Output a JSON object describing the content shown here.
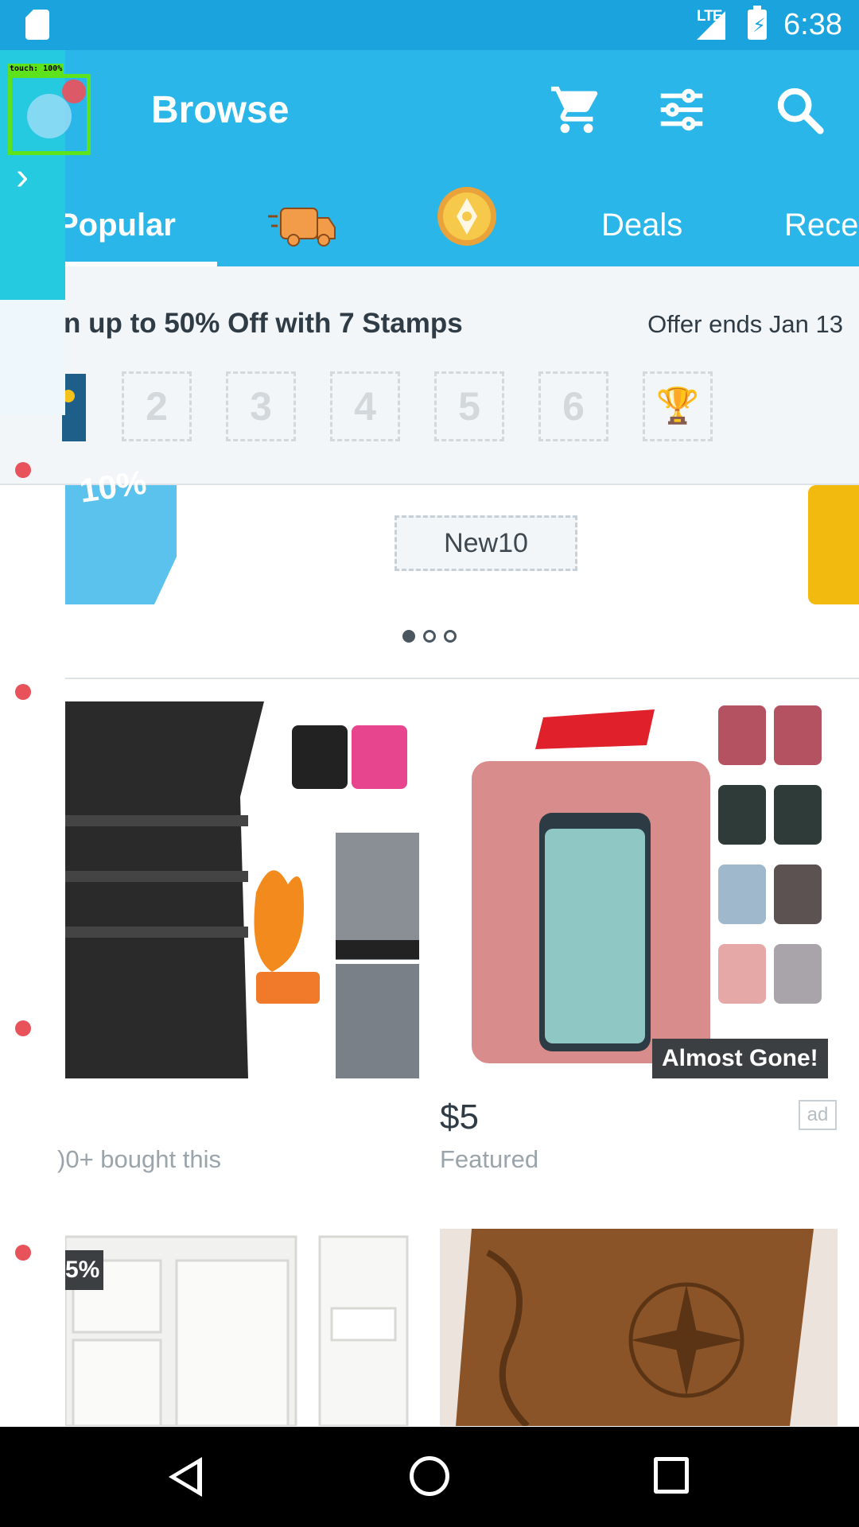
{
  "status_bar": {
    "network": "LTE",
    "time": "6:38"
  },
  "header": {
    "title": "Browse",
    "tabs": [
      {
        "label": "Popular"
      },
      {
        "label": "",
        "icon": "delivery-truck-icon"
      },
      {
        "label": "",
        "icon": "gold-coin-icon"
      },
      {
        "label": "Deals"
      },
      {
        "label": "Rece"
      }
    ]
  },
  "stamps": {
    "title": "n up to 50% Off with 7 Stamps",
    "offer_end": "Offer ends Jan 13",
    "slots": [
      "2",
      "3",
      "4",
      "5",
      "6"
    ]
  },
  "promo": {
    "discount": "10%",
    "code": "New10",
    "page_count": 3,
    "current_page": 1
  },
  "products": [
    {
      "meta": ")0+ bought this"
    },
    {
      "badge": "Almost Gone!",
      "price": "$5",
      "ad": "ad",
      "meta": "Featured"
    },
    {
      "badge": "5%"
    },
    {}
  ],
  "debug": {
    "touch_label": "touch: 100%"
  },
  "colors": {
    "status_bar": "#1aa3dc",
    "app_bar": "#2ab6e8",
    "stamp_bg": "#f3f6f8",
    "text_dark": "#2f3b45",
    "text_muted": "#9aa4ab"
  }
}
